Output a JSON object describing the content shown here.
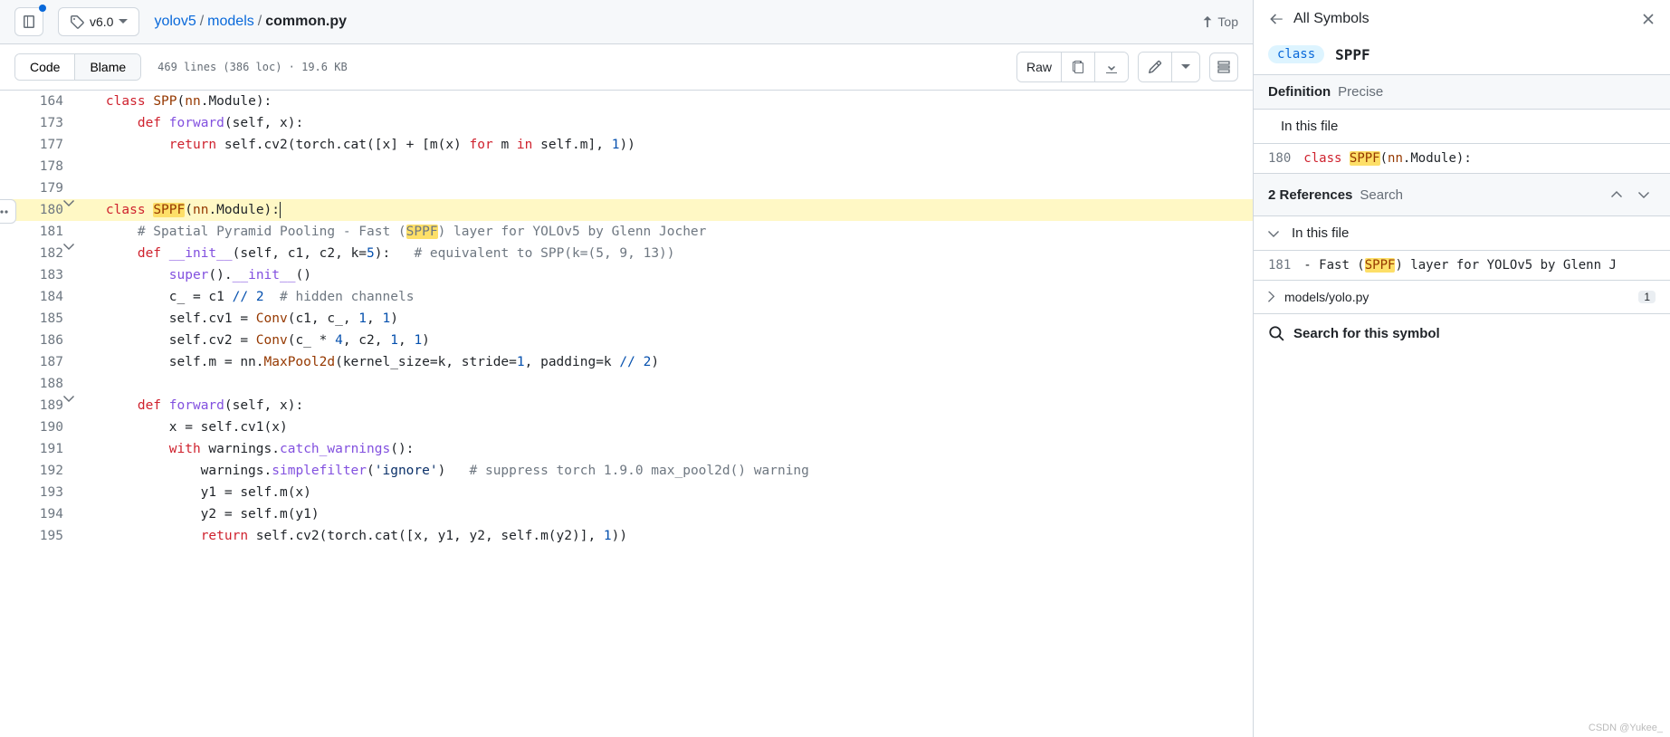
{
  "header": {
    "tag": "v6.0",
    "repo": "yolov5",
    "folder": "models",
    "file": "common.py",
    "top_label": "Top"
  },
  "toolbar": {
    "code_tab": "Code",
    "blame_tab": "Blame",
    "lines_info": "469 lines (386 loc) · 19.6 KB",
    "raw_label": "Raw"
  },
  "code": {
    "lines": [
      {
        "num": "164",
        "fold": "",
        "tokens": [
          [
            "",
            "    "
          ],
          [
            "kw",
            "class"
          ],
          [
            "",
            " "
          ],
          [
            "cls",
            "SPP"
          ],
          [
            "",
            "("
          ],
          [
            "cls",
            "nn"
          ],
          [
            "",
            ".Module):"
          ]
        ]
      },
      {
        "num": "173",
        "fold": "",
        "tokens": [
          [
            "",
            "        "
          ],
          [
            "kw",
            "def"
          ],
          [
            "",
            " "
          ],
          [
            "fn",
            "forward"
          ],
          [
            "",
            "("
          ],
          [
            "param",
            "self"
          ],
          [
            "",
            ", x):"
          ]
        ]
      },
      {
        "num": "177",
        "fold": "",
        "tokens": [
          [
            "",
            "            "
          ],
          [
            "kw",
            "return"
          ],
          [
            "",
            " self.cv2(torch.cat([x] + [m(x) "
          ],
          [
            "kw",
            "for"
          ],
          [
            "",
            " m "
          ],
          [
            "kw",
            "in"
          ],
          [
            "",
            " self.m], "
          ],
          [
            "num",
            "1"
          ],
          [
            "",
            "))"
          ]
        ]
      },
      {
        "num": "178",
        "fold": "",
        "tokens": [
          [
            "",
            ""
          ]
        ]
      },
      {
        "num": "179",
        "fold": "",
        "tokens": [
          [
            "",
            ""
          ]
        ]
      },
      {
        "num": "180",
        "fold": "v",
        "hl": true,
        "more": true,
        "tokens": [
          [
            "",
            "    "
          ],
          [
            "kw",
            "class"
          ],
          [
            "",
            " "
          ],
          [
            "hl",
            "SPPF"
          ],
          [
            "",
            "("
          ],
          [
            "cls",
            "nn"
          ],
          [
            "",
            ".Module):"
          ],
          [
            "cursor",
            ""
          ]
        ]
      },
      {
        "num": "181",
        "fold": "",
        "tokens": [
          [
            "",
            "        "
          ],
          [
            "com",
            "# Spatial Pyramid Pooling - Fast ("
          ],
          [
            "hlcom",
            "SPPF"
          ],
          [
            "com",
            ") layer for YOLOv5 by Glenn Jocher"
          ]
        ]
      },
      {
        "num": "182",
        "fold": "v",
        "tokens": [
          [
            "",
            "        "
          ],
          [
            "kw",
            "def"
          ],
          [
            "",
            " "
          ],
          [
            "fn",
            "__init__"
          ],
          [
            "",
            "("
          ],
          [
            "param",
            "self"
          ],
          [
            "",
            ", c1, c2, k="
          ],
          [
            "num",
            "5"
          ],
          [
            "",
            "):   "
          ],
          [
            "com",
            "# equivalent to SPP(k=(5, 9, 13))"
          ]
        ]
      },
      {
        "num": "183",
        "fold": "",
        "tokens": [
          [
            "",
            "            "
          ],
          [
            "fn",
            "super"
          ],
          [
            "",
            "()."
          ],
          [
            "fn",
            "__init__"
          ],
          [
            "",
            "()"
          ]
        ]
      },
      {
        "num": "184",
        "fold": "",
        "tokens": [
          [
            "",
            "            c_ = c1 "
          ],
          [
            "op",
            "//"
          ],
          [
            "",
            " "
          ],
          [
            "num",
            "2"
          ],
          [
            "",
            "  "
          ],
          [
            "com",
            "# hidden channels"
          ]
        ]
      },
      {
        "num": "185",
        "fold": "",
        "tokens": [
          [
            "",
            "            self.cv1 = "
          ],
          [
            "cls",
            "Conv"
          ],
          [
            "",
            "(c1, c_, "
          ],
          [
            "num",
            "1"
          ],
          [
            "",
            ", "
          ],
          [
            "num",
            "1"
          ],
          [
            "",
            ")"
          ]
        ]
      },
      {
        "num": "186",
        "fold": "",
        "tokens": [
          [
            "",
            "            self.cv2 = "
          ],
          [
            "cls",
            "Conv"
          ],
          [
            "",
            "(c_ * "
          ],
          [
            "num",
            "4"
          ],
          [
            "",
            ", c2, "
          ],
          [
            "num",
            "1"
          ],
          [
            "",
            ", "
          ],
          [
            "num",
            "1"
          ],
          [
            "",
            ")"
          ]
        ]
      },
      {
        "num": "187",
        "fold": "",
        "tokens": [
          [
            "",
            "            self.m = nn."
          ],
          [
            "cls",
            "MaxPool2d"
          ],
          [
            "",
            "(kernel_size=k, stride="
          ],
          [
            "num",
            "1"
          ],
          [
            "",
            ", padding=k "
          ],
          [
            "op",
            "//"
          ],
          [
            "",
            " "
          ],
          [
            "num",
            "2"
          ],
          [
            "",
            ")"
          ]
        ]
      },
      {
        "num": "188",
        "fold": "",
        "tokens": [
          [
            "",
            ""
          ]
        ]
      },
      {
        "num": "189",
        "fold": "v",
        "tokens": [
          [
            "",
            "        "
          ],
          [
            "kw",
            "def"
          ],
          [
            "",
            " "
          ],
          [
            "fn",
            "forward"
          ],
          [
            "",
            "("
          ],
          [
            "param",
            "self"
          ],
          [
            "",
            ", x):"
          ]
        ]
      },
      {
        "num": "190",
        "fold": "",
        "tokens": [
          [
            "",
            "            x = self.cv1(x)"
          ]
        ]
      },
      {
        "num": "191",
        "fold": "",
        "tokens": [
          [
            "",
            "            "
          ],
          [
            "kw",
            "with"
          ],
          [
            "",
            " warnings."
          ],
          [
            "fn",
            "catch_warnings"
          ],
          [
            "",
            "():"
          ]
        ]
      },
      {
        "num": "192",
        "fold": "",
        "tokens": [
          [
            "",
            "                warnings."
          ],
          [
            "fn",
            "simplefilter"
          ],
          [
            "",
            "("
          ],
          [
            "str",
            "'ignore'"
          ],
          [
            "",
            ")   "
          ],
          [
            "com",
            "# suppress torch 1.9.0 max_pool2d() warning"
          ]
        ]
      },
      {
        "num": "193",
        "fold": "",
        "tokens": [
          [
            "",
            "                y1 = self.m(x)"
          ]
        ]
      },
      {
        "num": "194",
        "fold": "",
        "tokens": [
          [
            "",
            "                y2 = self.m(y1)"
          ]
        ]
      },
      {
        "num": "195",
        "fold": "",
        "tokens": [
          [
            "",
            "                "
          ],
          [
            "kw",
            "return"
          ],
          [
            "",
            " self.cv2(torch.cat([x, y1, y2, self.m(y2)], "
          ],
          [
            "num",
            "1"
          ],
          [
            "",
            "))"
          ]
        ]
      }
    ]
  },
  "side": {
    "all_symbols": "All Symbols",
    "class_pill": "class",
    "symbol_name": "SPPF",
    "definition_label": "Definition",
    "definition_sub": "Precise",
    "in_this_file": "In this file",
    "def_line_num": "180",
    "def_line_tokens": [
      [
        "kw",
        "class"
      ],
      [
        "",
        " "
      ],
      [
        "hl",
        "SPPF"
      ],
      [
        "",
        "("
      ],
      [
        "cls",
        "nn"
      ],
      [
        "",
        ".Module):"
      ]
    ],
    "refs_count": "2",
    "refs_label": "References",
    "refs_search": "Search",
    "ref_line_num": "181",
    "ref_line_tokens": [
      [
        "",
        "- Fast ("
      ],
      [
        "hl",
        "SPPF"
      ],
      [
        "",
        ") layer for YOLOv5 by Glenn J"
      ]
    ],
    "file_ref": "models/yolo.py",
    "file_ref_count": "1",
    "search_symbol": "Search for this symbol"
  },
  "watermark": "CSDN @Yukee_"
}
